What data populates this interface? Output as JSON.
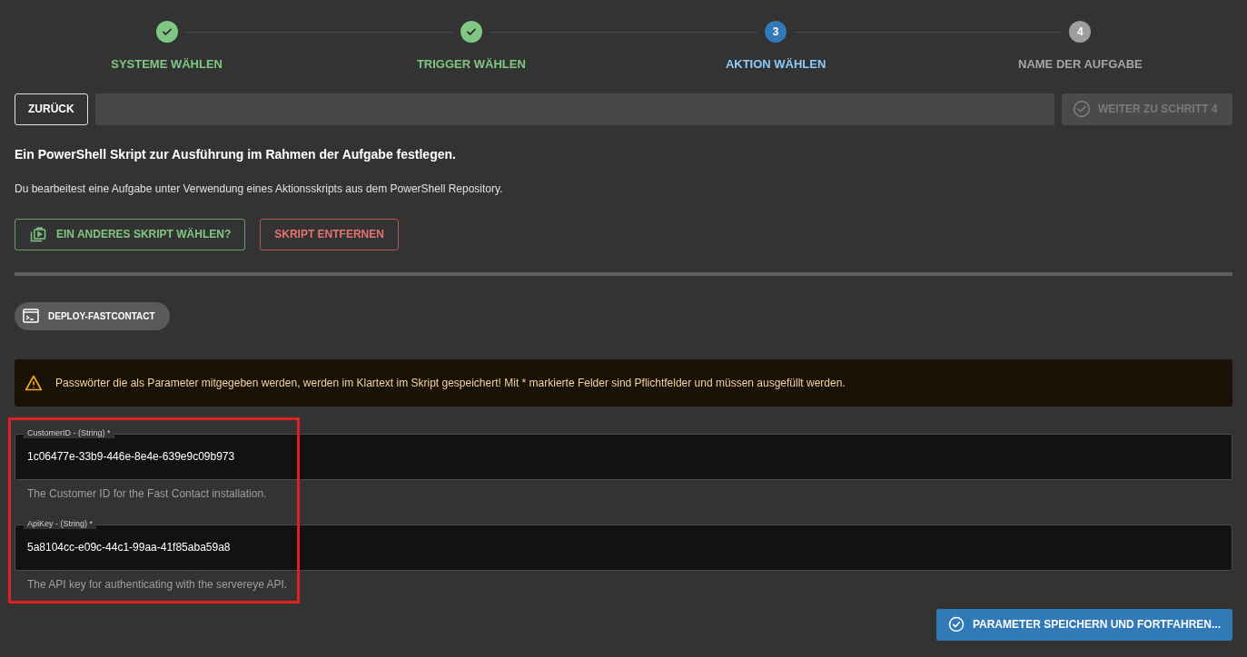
{
  "steps": [
    {
      "label": "SYSTEME WÄHLEN",
      "completed": true,
      "selected": false
    },
    {
      "label": "TRIGGER WÄHLEN",
      "completed": true,
      "selected": false
    },
    {
      "label": "AKTION WÄHLEN",
      "completed": false,
      "selected": true,
      "number": "3"
    },
    {
      "label": "NAME DER AUFGABE",
      "completed": false,
      "selected": false,
      "number": "4"
    }
  ],
  "toolbar": {
    "back_button": "ZURÜCK",
    "next_button": {
      "label": "WEITER ZU SCHRITT 4",
      "disabled": true
    }
  },
  "heading": "Ein PowerShell Skript zur Ausführung im Rahmen der Aufgabe festlegen.",
  "description": "Du bearbeitest eine Aufgabe unter Verwendung eines Aktionsskripts aus dem PowerShell Repository.",
  "actions": [
    {
      "label": "EIN ANDERES SKRIPT WÄHLEN?",
      "kind": "choose"
    },
    {
      "label": "SKRIPT ENTFERNEN",
      "kind": "remove"
    }
  ],
  "script_chip": "DEPLOY-FASTCONTACT",
  "warning": "Passwörter die als Parameter mitgegeben werden, werden im Klartext im Skript gespeichert! Mit * markierte Felder sind Pflichtfelder und müssen ausgefüllt werden.",
  "parameters": [
    {
      "label": "CustomerID - (String) *",
      "value": "1c06477e-33b9-446e-8e4e-639e9c09b973",
      "help": "The Customer ID for the Fast Contact installation."
    },
    {
      "label": "ApiKey - (String) *",
      "value": "5a8104cc-e09c-44c1-99aa-41f85aba59a8",
      "help": "The API key for authenticating with the servereye API."
    }
  ],
  "save_button": "PARAMETER SPEICHERN UND FORTFAHREN..."
}
